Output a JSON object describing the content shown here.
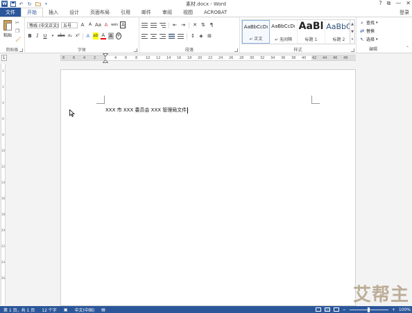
{
  "titlebar": {
    "title": "素材.docx - Word",
    "help": "?",
    "restore": "⧉",
    "minimize": "—",
    "close": "✕"
  },
  "tabs": {
    "file": "文件",
    "items": [
      "开始",
      "插入",
      "设计",
      "页面布局",
      "引用",
      "邮件",
      "审阅",
      "视图",
      "ACROBAT"
    ],
    "login": "登录"
  },
  "ribbon": {
    "clipboard": {
      "paste": "粘贴",
      "group": "剪贴板"
    },
    "font": {
      "font_name": "等线 (中文正文)",
      "font_size": "五号",
      "grow": "A",
      "shrink": "A",
      "change_case": "Aa",
      "clear": "A",
      "phonetic": "wén",
      "border_char": "A",
      "bold": "B",
      "italic": "I",
      "underline": "U",
      "strike": "abc",
      "subscript": "x₂",
      "superscript": "x²",
      "text_effects": "A",
      "highlight": "ab",
      "font_color": "A",
      "shade": "A",
      "enclose": "字",
      "group": "字体"
    },
    "paragraph": {
      "group": "段落"
    },
    "styles": {
      "items": [
        {
          "preview": "AaBbCcDı",
          "name": "↵ 正文"
        },
        {
          "preview": "AaBbCcDı",
          "name": "↵ 无间隔"
        },
        {
          "preview": "AaBl",
          "name": "标题 1"
        },
        {
          "preview": "AaBbC",
          "name": "标题 2"
        }
      ],
      "group": "样式"
    },
    "editing": {
      "find": "查找",
      "replace": "替换",
      "select": "选择",
      "group": "编辑"
    }
  },
  "ruler": {
    "h_ticks": [
      "8",
      "6",
      "4",
      "2",
      "2",
      "4",
      "6",
      "8",
      "10",
      "12",
      "14",
      "16",
      "18",
      "20",
      "22",
      "24",
      "26",
      "28",
      "30",
      "32",
      "34",
      "36",
      "38",
      "40",
      "42",
      "44",
      "46",
      "48"
    ],
    "v_ticks": [
      "2",
      "2",
      "4",
      "6",
      "8",
      "10",
      "12",
      "14",
      "16",
      "18",
      "20",
      "22",
      "24",
      "26"
    ],
    "corner": "L"
  },
  "document": {
    "text": "XXX 市 XXX 委员会 XXX 管理局文件"
  },
  "statusbar": {
    "page": "第 1 页，共 1 页",
    "words": "12 个字",
    "lang": "中文(中国)",
    "zoom": "100%",
    "zoom_minus": "−",
    "zoom_plus": "+",
    "zoom_level": 0.5
  },
  "watermark": "艾帮主"
}
